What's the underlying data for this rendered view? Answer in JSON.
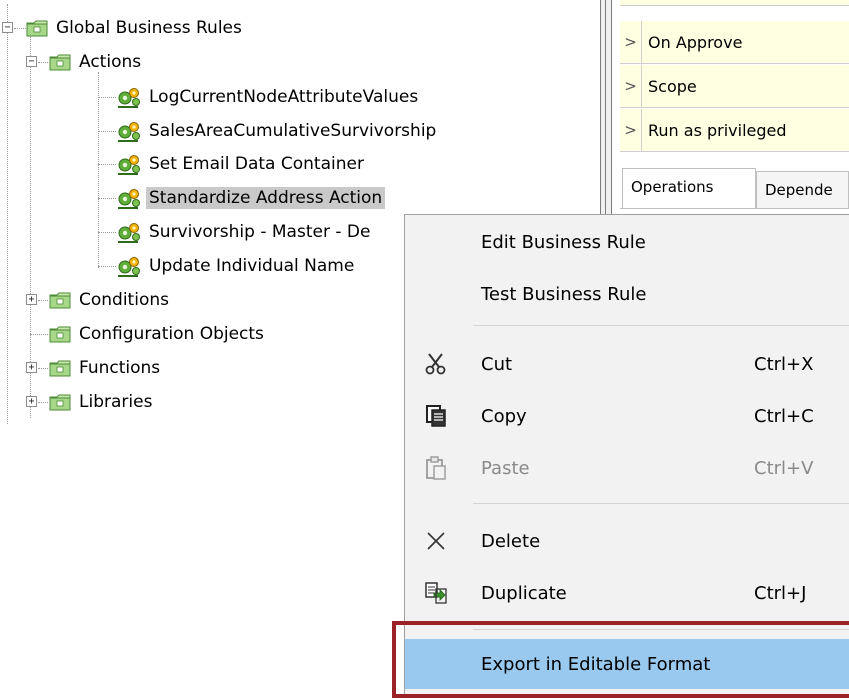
{
  "tree": {
    "root": {
      "label": "Global Business Rules",
      "expanded": true
    },
    "actions": {
      "label": "Actions",
      "expanded": true,
      "items": [
        {
          "label": "LogCurrentNodeAttributeValues"
        },
        {
          "label": "SalesAreaCumulativeSurvivorship"
        },
        {
          "label": "Set Email Data Container"
        },
        {
          "label": "Standardize Address Action",
          "selected": true
        },
        {
          "label": "Survivorship - Master - De"
        },
        {
          "label": "Update Individual Name"
        }
      ]
    },
    "siblings": [
      {
        "label": "Conditions",
        "expandable": true
      },
      {
        "label": "Configuration Objects",
        "expandable": false
      },
      {
        "label": "Functions",
        "expandable": true
      },
      {
        "label": "Libraries",
        "expandable": true
      }
    ]
  },
  "properties": {
    "rows": [
      {
        "chevron": ">",
        "label": "On Approve"
      },
      {
        "chevron": ">",
        "label": "Scope"
      },
      {
        "chevron": ">",
        "label": "Run as privileged"
      }
    ]
  },
  "tabs": [
    {
      "label": "Operations",
      "active": true
    },
    {
      "label": "Depende",
      "active": false
    }
  ],
  "context_menu": {
    "items": [
      {
        "label": "Edit Business Rule",
        "shortcut": "",
        "icon": "none"
      },
      {
        "label": "Test Business Rule",
        "shortcut": "",
        "icon": "none"
      },
      {
        "label": "Cut",
        "shortcut": "Ctrl+X",
        "icon": "scissors-icon"
      },
      {
        "label": "Copy",
        "shortcut": "Ctrl+C",
        "icon": "copy-icon"
      },
      {
        "label": "Paste",
        "shortcut": "Ctrl+V",
        "icon": "paste-icon",
        "disabled": true
      },
      {
        "label": "Delete",
        "shortcut": "",
        "icon": "delete-x-icon"
      },
      {
        "label": "Duplicate",
        "shortcut": "Ctrl+J",
        "icon": "duplicate-icon"
      },
      {
        "label": "Export in Editable Format",
        "shortcut": "",
        "icon": "none",
        "highlighted": true
      }
    ]
  },
  "colors": {
    "selection": "#c9c9c9",
    "property_row_bg": "#ffffe1",
    "menu_bg": "#f2f2f2",
    "menu_highlight": "#99c9ef",
    "annotation_frame": "#9b2226",
    "folder_green": "#7fbf5a"
  }
}
